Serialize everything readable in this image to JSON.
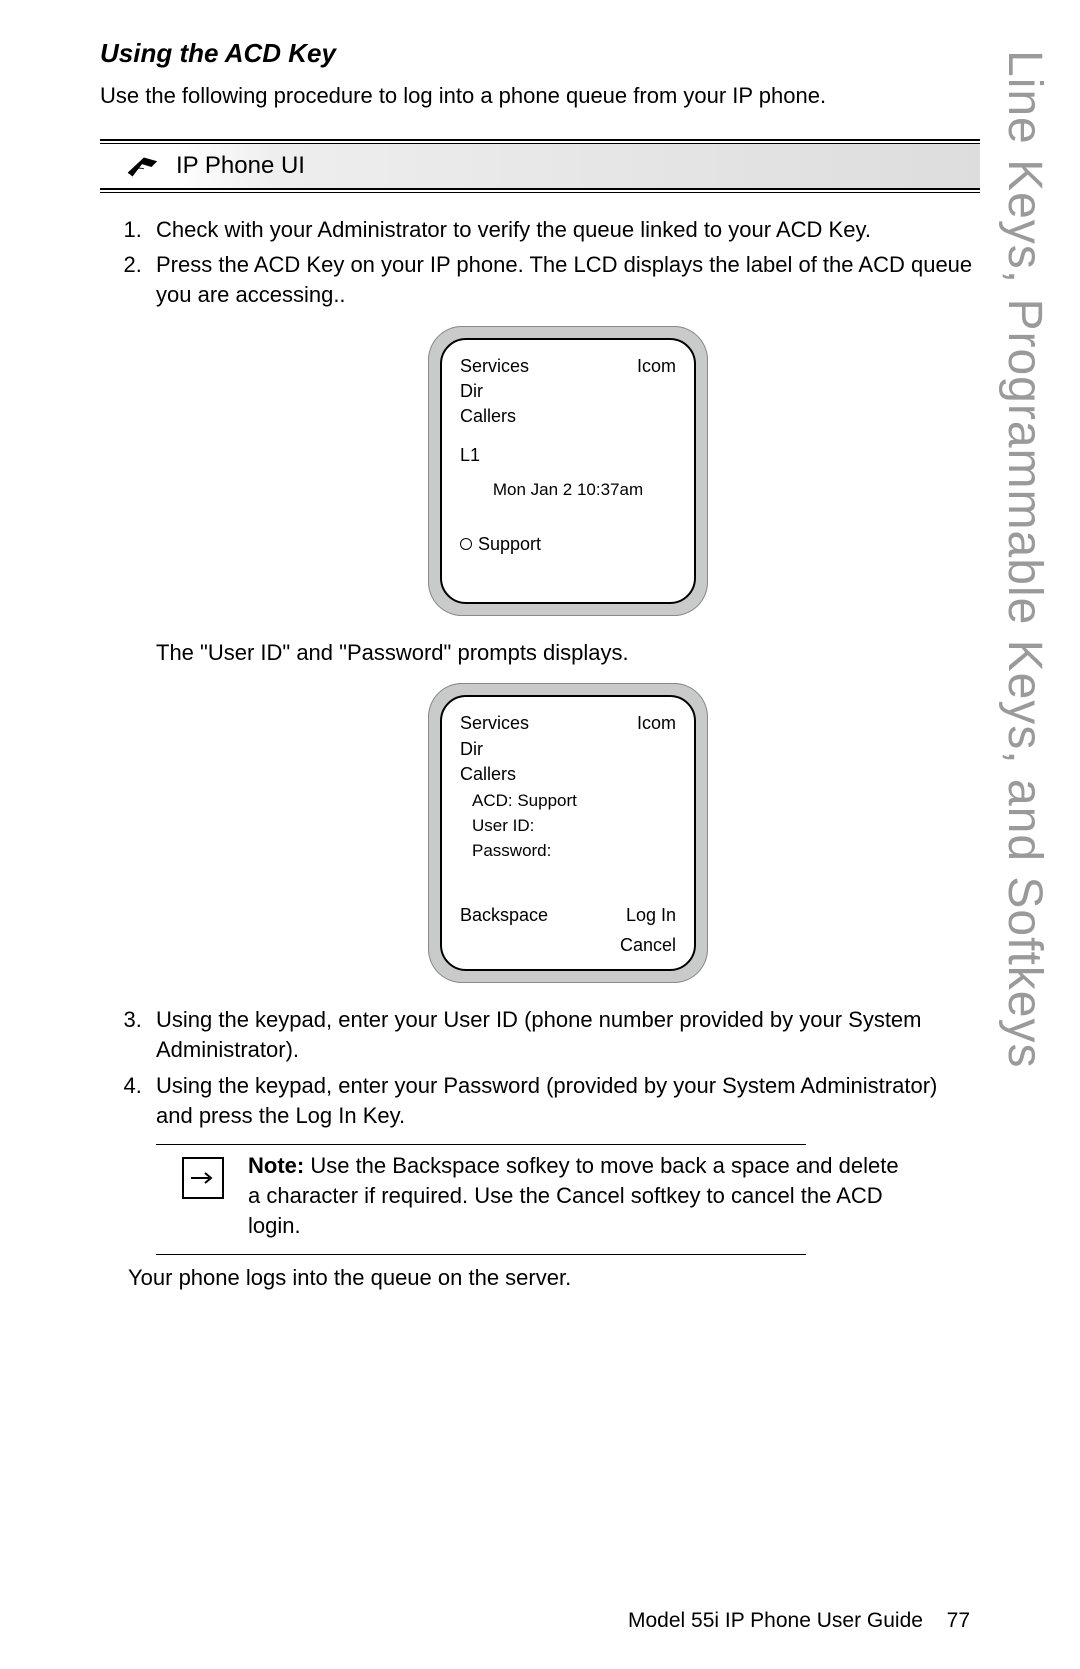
{
  "sidebar": "Line Keys, Programmable Keys, and Softkeys",
  "heading": "Using the ACD Key",
  "intro": "Use the following procedure to log into a phone queue from your IP phone.",
  "callout_title": "IP Phone UI",
  "steps": {
    "s1": "Check with your Administrator to verify the queue linked to your ACD Key.",
    "s2_a": "Press the ",
    "s2_b": "ACD Key",
    "s2_c": " on your IP phone. The LCD displays the label of the ACD queue you are accessing..",
    "s3_a": "Using the keypad, enter your User ID ",
    "s3_b": "(phone number provided by your System Administrator).",
    "s4_a": "Using the keypad, enter your Password ",
    "s4_b": "(provided by your System Administrator) ",
    "s4_c": "and press the ",
    "s4_d": "Log In",
    "s4_e": " Key."
  },
  "mid_text": "The \"User ID\" and \"Password\" prompts displays.",
  "phone1": {
    "services": "Services",
    "icom": "Icom",
    "dir": "Dir",
    "callers": "Callers",
    "l1": "L1",
    "date": "Mon Jan 2 10:37am",
    "support": "Support"
  },
  "phone2": {
    "services": "Services",
    "icom": "Icom",
    "dir": "Dir",
    "callers": "Callers",
    "acd": "ACD: Support",
    "userid": "User ID:",
    "password": "Password:",
    "backspace": "Backspace",
    "login": "Log In",
    "cancel": "Cancel"
  },
  "note": {
    "label": "Note:",
    "t1": " Use the ",
    "b1": "Backspace",
    "t2": " sofkey to move back a space and delete a character if required. Use the ",
    "b2": "Cancel",
    "t3": " softkey to cancel the ACD login."
  },
  "closing": "Your phone logs into the queue on the server.",
  "footer_a": "Model 55i IP Phone User Guide",
  "footer_b": "77"
}
